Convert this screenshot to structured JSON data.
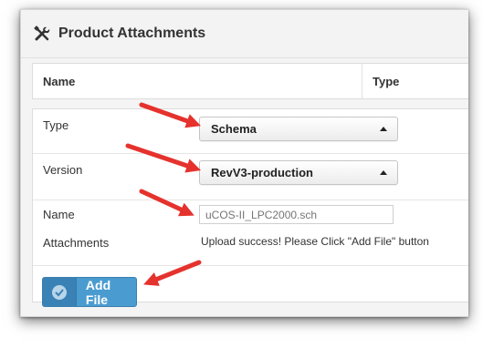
{
  "panel": {
    "title": "Product Attachments",
    "icon": "tools-icon"
  },
  "table": {
    "columns": [
      "Name",
      "Type"
    ]
  },
  "form": {
    "type_label": "Type",
    "type_value": "Schema",
    "version_label": "Version",
    "version_value": "RevV3-production",
    "name_label": "Name",
    "name_placeholder": "uCOS-II_LPC2000.sch",
    "attachments_label": "Attachments",
    "upload_message": "Upload success! Please Click \"Add File\" button",
    "add_file_label": "Add File"
  },
  "colors": {
    "accent": "#4a9cd0",
    "annotation_arrow": "#e5322d"
  }
}
